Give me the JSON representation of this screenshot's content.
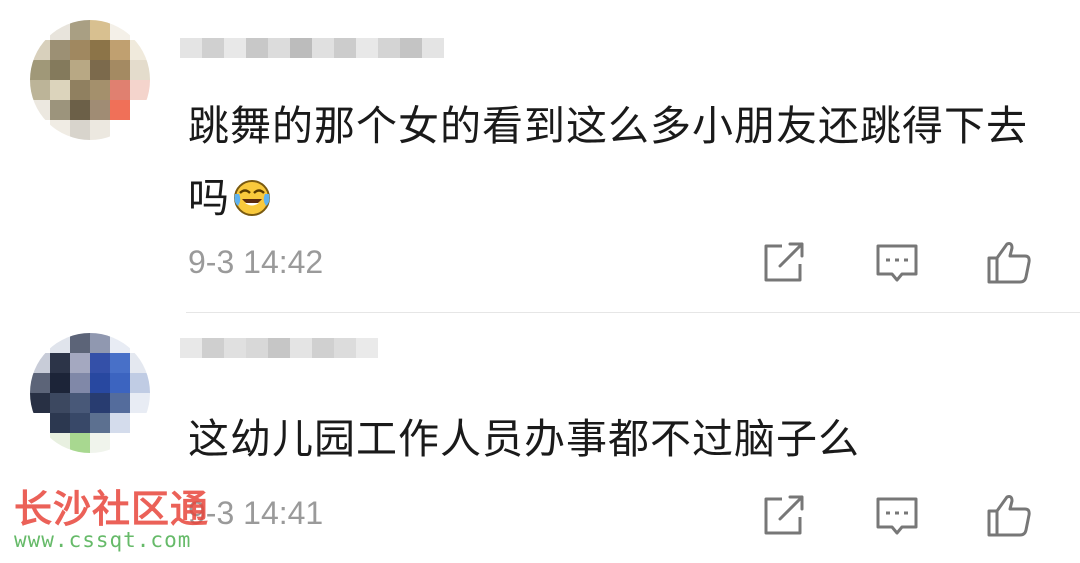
{
  "comments": [
    {
      "text": "跳舞的那个女的看到这么多小朋友还跳得下去吗",
      "emoji": "face-with-tears-of-joy-emoji",
      "time": "9-3 14:42"
    },
    {
      "text": "这幼儿园工作人员办事都不过脑子么",
      "time": "9-3 14:41"
    }
  ],
  "actions": {
    "share": "share-icon",
    "reply": "comment-icon",
    "like": "thumbs-up-icon"
  },
  "watermark": {
    "title": "长沙社区通",
    "url": "www.cssqt.com"
  },
  "colors": {
    "text": "#1a1a1a",
    "time": "#9a9a9a",
    "icon": "#777777",
    "divider": "#e6e6e6",
    "watermark_red": "#e8463c",
    "watermark_green": "#4caf50"
  }
}
